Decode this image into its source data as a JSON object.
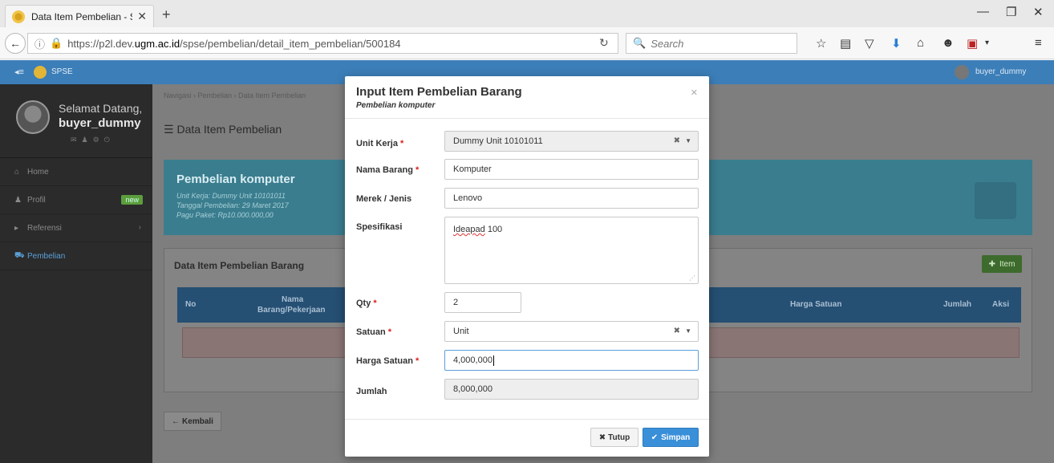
{
  "browser": {
    "tab_title": "Data Item Pembelian - SPSE",
    "url_prefix": "https://p2l.dev.",
    "url_host": "ugm.ac.id",
    "url_path": "/spse/pembelian/detail_item_pembelian/500184",
    "search_placeholder": "Search"
  },
  "app": {
    "brand": "SPSE",
    "username": "buyer_dummy"
  },
  "sidebar": {
    "welcome": "Selamat Datang,",
    "user": "buyer_dummy",
    "items": [
      {
        "label": "Home"
      },
      {
        "label": "Profil",
        "badge": "new"
      },
      {
        "label": "Referensi"
      },
      {
        "label": "Pembelian"
      }
    ]
  },
  "content": {
    "breadcrumb": "Navigasi  ›  Pembelian  ›  Data Item Pembelian",
    "page_title": "Data Item Pembelian",
    "info": {
      "title": "Pembelian komputer",
      "unit_kerja": "Unit Kerja: Dummy Unit 10101011",
      "tanggal": "Tanggal Pembelian: 29 Maret 2017",
      "pagu": "Pagu Paket: Rp10.000.000,00"
    },
    "panel_title": "Data Item Pembelian Barang",
    "add_button": "Item",
    "table_headers": {
      "no": "No",
      "nama": "Nama",
      "nama2": "Barang/Pekerjaan",
      "harga": "Harga Satuan",
      "jumlah": "Jumlah",
      "aksi": "Aksi"
    },
    "back_button": "Kembali"
  },
  "modal": {
    "title": "Input Item Pembelian Barang",
    "subtitle": "Pembelian komputer",
    "fields": {
      "unit_kerja": {
        "label": "Unit Kerja",
        "value": "Dummy Unit 10101011"
      },
      "nama_barang": {
        "label": "Nama Barang",
        "value": "Komputer"
      },
      "merek": {
        "label": "Merek / Jenis",
        "value": "Lenovo"
      },
      "spesifikasi": {
        "label": "Spesifikasi",
        "value_word": "Ideapad",
        "value_rest": " 100"
      },
      "qty": {
        "label": "Qty",
        "value": "2"
      },
      "satuan": {
        "label": "Satuan",
        "value": "Unit"
      },
      "harga_satuan": {
        "label": "Harga Satuan",
        "value": "4,000,000"
      },
      "jumlah": {
        "label": "Jumlah",
        "value": "8,000,000"
      }
    },
    "close_button": "Tutup",
    "save_button": "Simpan"
  }
}
